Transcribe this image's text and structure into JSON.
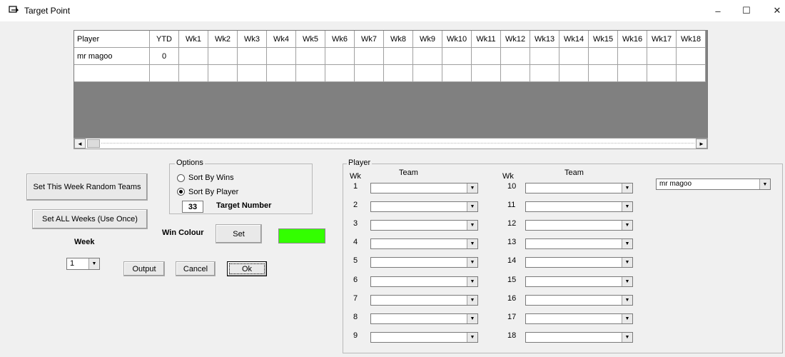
{
  "window": {
    "title": "Target Point",
    "controls": {
      "minimize": "–",
      "maximize": "☐",
      "close": "✕"
    }
  },
  "grid": {
    "headers": [
      "Player",
      "YTD",
      "Wk1",
      "Wk2",
      "Wk3",
      "Wk4",
      "Wk5",
      "Wk6",
      "Wk7",
      "Wk8",
      "Wk9",
      "Wk10",
      "Wk11",
      "Wk12",
      "Wk13",
      "Wk14",
      "Wk15",
      "Wk16",
      "Wk17",
      "Wk18"
    ],
    "rows": [
      {
        "player": "mr magoo",
        "ytd": "0"
      },
      {
        "player": "",
        "ytd": ""
      }
    ],
    "scroll_left": "◄",
    "scroll_right": "►"
  },
  "buttons": {
    "set_week_random": "Set This Week Random Teams",
    "set_all_weeks": "Set ALL Weeks (Use Once)",
    "set_colour": "Set",
    "output": "Output",
    "cancel": "Cancel",
    "ok": "Ok"
  },
  "options": {
    "legend": "Options",
    "sort_by_wins": "Sort By Wins",
    "sort_by_player": "Sort By Player",
    "selected": "sort_by_player",
    "target_value": "33",
    "target_label": "Target Number"
  },
  "win_colour": {
    "label": "Win Colour",
    "color": "#33ff00"
  },
  "week": {
    "label": "Week",
    "value": "1"
  },
  "player_panel": {
    "legend": "Player",
    "wk_label": "Wk",
    "team_label": "Team",
    "left_weeks": [
      "1",
      "2",
      "3",
      "4",
      "5",
      "6",
      "7",
      "8",
      "9"
    ],
    "right_weeks": [
      "10",
      "11",
      "12",
      "13",
      "14",
      "15",
      "16",
      "17",
      "18"
    ],
    "player_select": "mr magoo"
  }
}
